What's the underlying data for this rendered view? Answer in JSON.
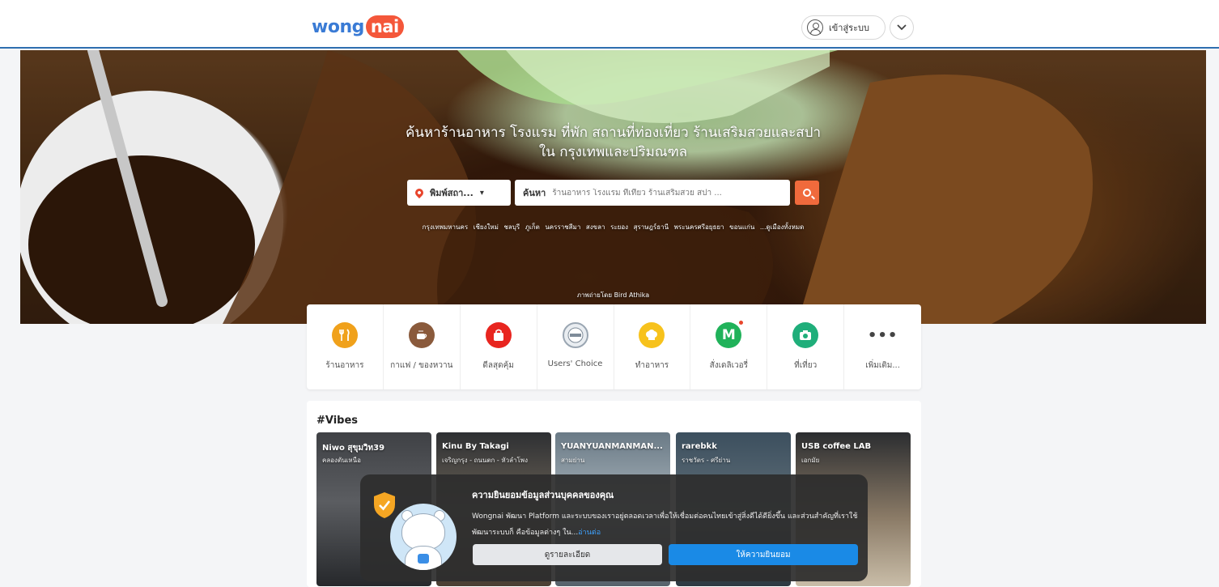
{
  "header": {
    "logo_text_1": "wong",
    "logo_text_2": "nai",
    "login_label": "เข้าสู่ระบบ",
    "brand_color": "#f4573a",
    "accent_color": "#2f6fb0"
  },
  "hero": {
    "title_line_1": "ค้นหาร้านอาหาร โรงแรม ที่พัก สถานที่ท่องเที่ยว ร้านเสริมสวยและสปา",
    "title_line_2": "ใน กรุงเทพและปริมณฑล",
    "location_label": "พิมพ์สถา...",
    "search_label": "ค้นหา",
    "search_placeholder": "ร้านอาหาร โรงแรม ที่เที่ยว ร้านเสริมสวย สปา ...",
    "cities": [
      "กรุงเทพมหานคร",
      "เชียงใหม่",
      "ชลบุรี",
      "ภูเก็ต",
      "นครราชสีมา",
      "สงขลา",
      "ระยอง",
      "สุราษฎร์ธานี",
      "พระนครศรีอยุธยา",
      "ขอนแก่น",
      "...ดูเมืองทั้งหมด"
    ],
    "photo_credit": "ภาพถ่ายโดย Bird Athika"
  },
  "categories": [
    {
      "label": "ร้านอาหาร",
      "icon": "fork-knife-icon",
      "color": "#f0a11b"
    },
    {
      "label": "กาแฟ / ของหวาน",
      "icon": "coffee-icon",
      "color": "#8a5a3c"
    },
    {
      "label": "ดีลสุดคุ้ม",
      "icon": "shopping-bag-icon",
      "color": "#e8251f"
    },
    {
      "label": "Users' Choice",
      "icon": "users-choice-badge-icon",
      "color": "#9aa6b2"
    },
    {
      "label": "ทำอาหาร",
      "icon": "chef-hat-icon",
      "color": "#f7c21c"
    },
    {
      "label": "สั่งเดลิเวอรี่",
      "icon": "delivery-m-icon",
      "color": "#20b25a"
    },
    {
      "label": "ที่เที่ยว",
      "icon": "camera-icon",
      "color": "#1fae7a"
    },
    {
      "label": "เพิ่มเติม...",
      "icon": "more-dots-icon",
      "color": "#ffffff"
    }
  ],
  "vibes": {
    "title": "#Vibes",
    "items": [
      {
        "name": "Niwo สุขุมวิท39",
        "sub": "คลองตันเหนือ"
      },
      {
        "name": "Kinu By Takagi",
        "sub": "เจริญกรุง - ถนนตก - หัวลำโพง"
      },
      {
        "name": "YUANYUANMANMAN...",
        "sub": "สามย่าน"
      },
      {
        "name": "rarebkk",
        "sub": "ราชวัตร - ศรีย่าน"
      },
      {
        "name": "USB coffee LAB",
        "sub": "เอกมัย"
      }
    ]
  },
  "consent": {
    "title": "ความยินยอมข้อมูลส่วนบุคคลของคุณ",
    "text": "Wongnai พัฒนา Platform และระบบของเราอยู่ตลอดเวลาเพื่อให้เชื่อมต่อคนไทยเข้าสู่สิ่งดีได้ดียิ่งขึ้น และส่วนสำคัญที่เราใช้พัฒนาระบบก็ คือข้อมูลต่างๆ ใน...",
    "read_more": "อ่านต่อ",
    "detail_button": "ดูรายละเอียด",
    "accept_button": "ให้ความยินยอม"
  }
}
